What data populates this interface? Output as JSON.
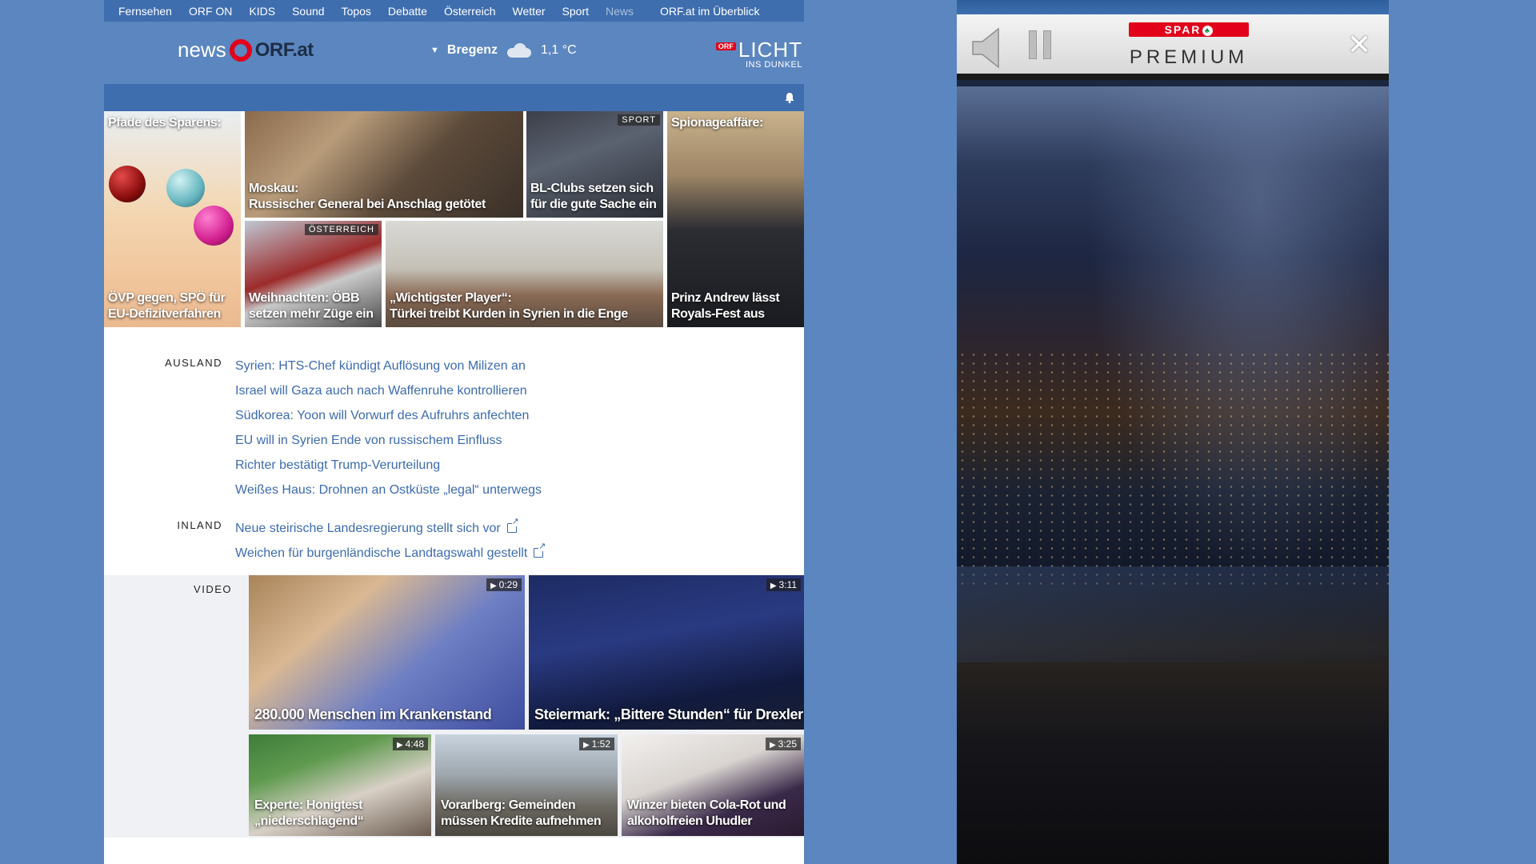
{
  "topnav": {
    "items": [
      "Fernsehen",
      "ORF ON",
      "KIDS",
      "Sound",
      "Topos",
      "Debatte",
      "Österreich",
      "Wetter",
      "Sport",
      "News"
    ],
    "overview": "ORF.at im Überblick"
  },
  "header": {
    "logo_news": "news",
    "logo_orf": "ORF.at",
    "weather_location": "Bregenz",
    "weather_temp": "1,1 °C",
    "licht_badge": "ORF",
    "licht_title": "LICHT",
    "licht_sub": "INS DUNKEL"
  },
  "hero": {
    "t1": {
      "top": "Pfade des Sparens:",
      "caption": "ÖVP gegen, SPÖ für EU-Defizitverfahren"
    },
    "t2": {
      "caption_l1": "Moskau:",
      "caption_l2": "Russischer General bei Anschlag getötet"
    },
    "t3": {
      "tag": "SPORT",
      "caption": "BL-Clubs setzen sich für die gute Sache ein"
    },
    "t4": {
      "top": "Spionageaffäre:",
      "caption": "Prinz Andrew lässt Royals-Fest aus"
    },
    "t5": {
      "tag": "ÖSTERREICH",
      "caption": "Weihnachten: ÖBB setzen mehr Züge ein"
    },
    "t6": {
      "caption_l1": "„Wichtigster Player“:",
      "caption_l2": "Türkei treibt Kurden in Syrien in die Enge"
    }
  },
  "news": {
    "ausland_label": "AUSLAND",
    "ausland": [
      "Syrien: HTS-Chef kündigt Auflösung von Milizen an",
      "Israel will Gaza auch nach Waffenruhe kontrollieren",
      "Südkorea: Yoon will Vorwurf des Aufruhrs anfechten",
      "EU will in Syrien Ende von russischem Einfluss",
      "Richter bestätigt Trump-Verurteilung",
      "Weißes Haus: Drohnen an Ostküste „legal“ unterwegs"
    ],
    "inland_label": "INLAND",
    "inland": [
      "Neue steirische Landesregierung stellt sich vor",
      "Weichen für burgenländische Landtagswahl gestellt"
    ]
  },
  "video": {
    "label": "VIDEO",
    "v1": {
      "duration": "0:29",
      "caption": "280.000 Menschen im Krankenstand"
    },
    "v2": {
      "duration": "3:11",
      "caption": "Steiermark: „Bittere Stunden“ für Drexler"
    },
    "v3": {
      "duration": "4:48",
      "caption": "Experte: Honigtest „niederschlagend“"
    },
    "v4": {
      "duration": "1:52",
      "caption": "Vorarlberg: Gemeinden müssen Kredite aufnehmen"
    },
    "v5": {
      "duration": "3:25",
      "caption": "Winzer bieten Cola-Rot und alkoholfreien Uhudler"
    }
  },
  "ad": {
    "brand": "SPAR",
    "title": "PREMIUM",
    "close": "✕"
  },
  "colors": {
    "page_bg": "#5b86bf",
    "nav_bg": "#3f6eae",
    "link": "#3d6bb0",
    "orf_red": "#e2001a"
  }
}
